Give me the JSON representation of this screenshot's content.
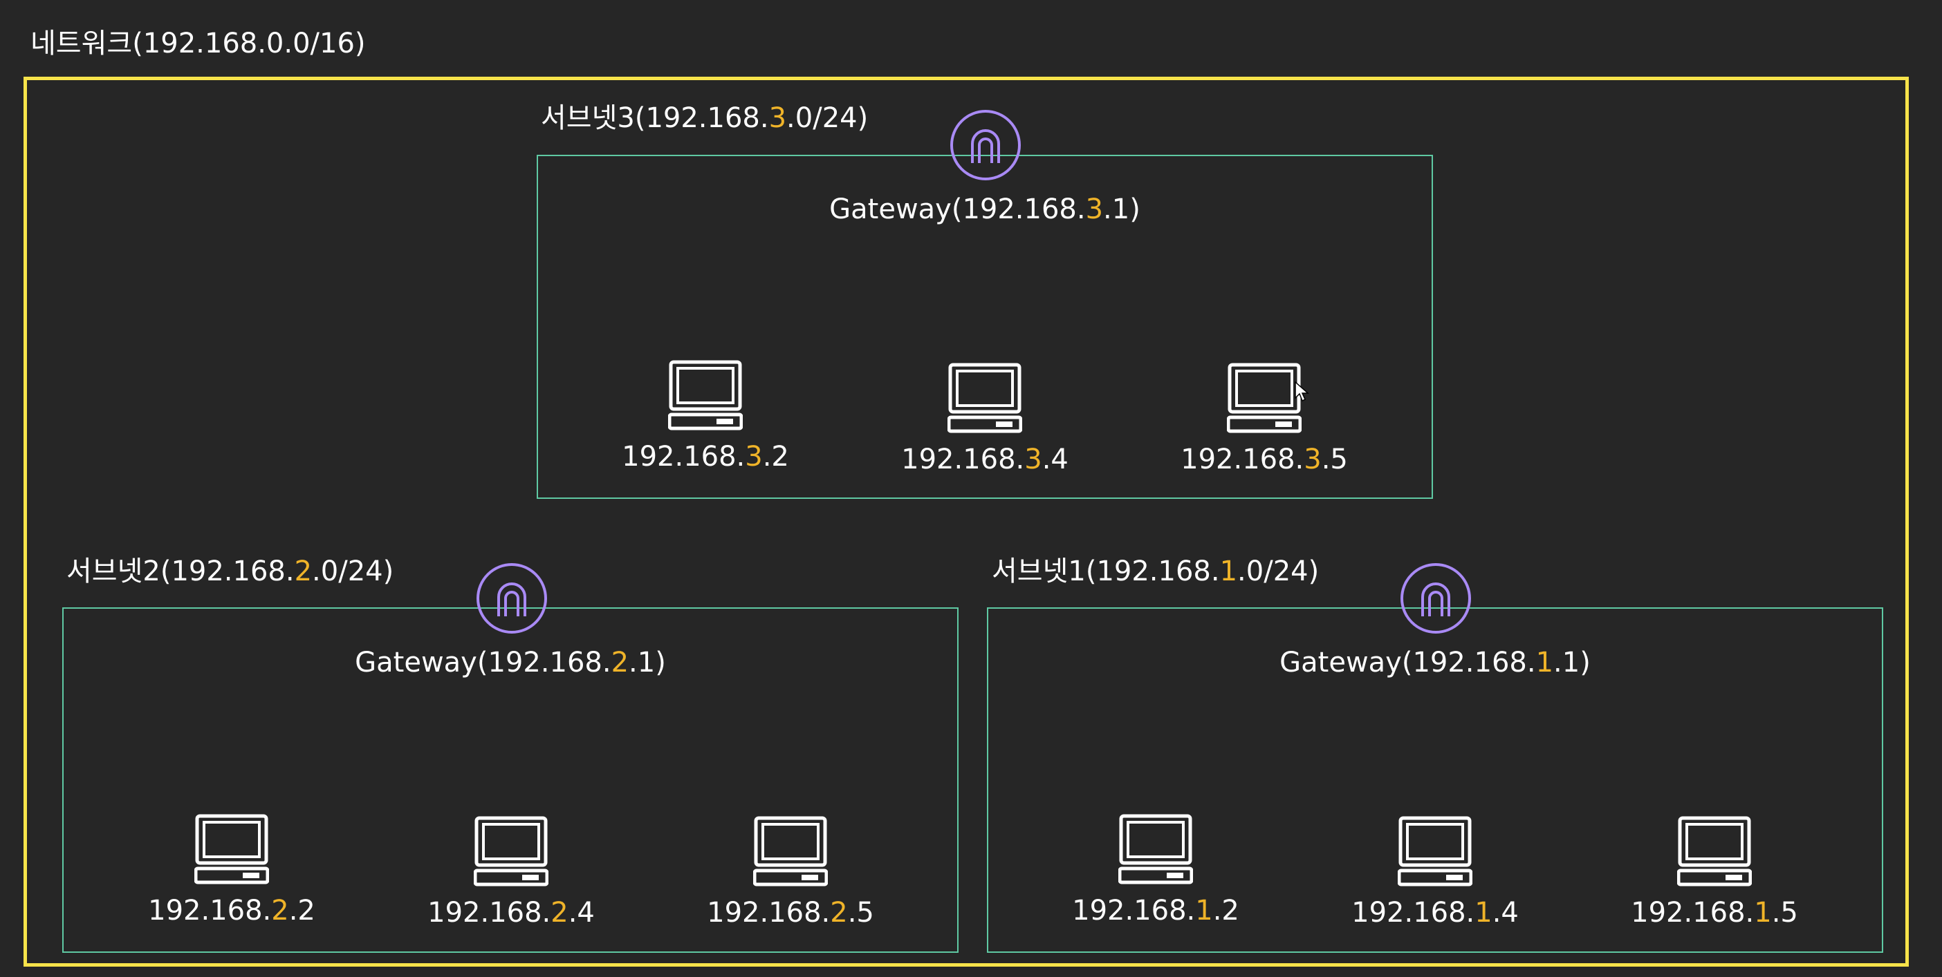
{
  "network": {
    "title_prefix": "네트워크(192.168.0.0/16)"
  },
  "colors": {
    "background": "#262626",
    "network_border": "#f7e34a",
    "subnet_border": "#5fc9a3",
    "gateway_icon": "#a98af5",
    "highlight": "#f0b429",
    "text": "#ffffff"
  },
  "icons": {
    "gateway": "gateway-arch-icon",
    "host": "computer-icon"
  },
  "subnet3": {
    "title_prefix": "서브넷3(192.168.",
    "title_octet": "3",
    "title_suffix": ".0/24)",
    "gateway": {
      "prefix": "Gateway(192.168.",
      "octet": "3",
      "suffix": ".1)"
    },
    "hosts": [
      {
        "prefix": "192.168.",
        "octet": "3",
        "suffix": ".2"
      },
      {
        "prefix": "192.168.",
        "octet": "3",
        "suffix": ".4"
      },
      {
        "prefix": "192.168.",
        "octet": "3",
        "suffix": ".5"
      }
    ]
  },
  "subnet2": {
    "title_prefix": "서브넷2(192.168.",
    "title_octet": "2",
    "title_suffix": ".0/24)",
    "gateway": {
      "prefix": "Gateway(192.168.",
      "octet": "2",
      "suffix": ".1)"
    },
    "hosts": [
      {
        "prefix": "192.168.",
        "octet": "2",
        "suffix": ".2"
      },
      {
        "prefix": "192.168.",
        "octet": "2",
        "suffix": ".4"
      },
      {
        "prefix": "192.168.",
        "octet": "2",
        "suffix": ".5"
      }
    ]
  },
  "subnet1": {
    "title_prefix": "서브넷1(192.168.",
    "title_octet": "1",
    "title_suffix": ".0/24)",
    "gateway": {
      "prefix": "Gateway(192.168.",
      "octet": "1",
      "suffix": ".1)"
    },
    "hosts": [
      {
        "prefix": "192.168.",
        "octet": "1",
        "suffix": ".2"
      },
      {
        "prefix": "192.168.",
        "octet": "1",
        "suffix": ".4"
      },
      {
        "prefix": "192.168.",
        "octet": "1",
        "suffix": ".5"
      }
    ]
  }
}
